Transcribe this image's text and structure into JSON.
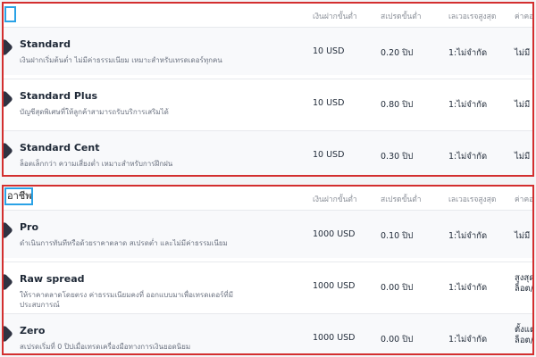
{
  "columns": [
    "เงินฝากขั้นต่ำ",
    "สเปรดขั้นต่ำ",
    "เลเวอเรจสูงสุด",
    "ค่าคอม"
  ],
  "standard_section": {
    "rows": [
      {
        "name": "Standard",
        "desc": "เงินฝากเริ่มต้นต่ำ ไม่มีค่าธรรมเนียม เหมาะสำหรับเทรดเดอร์ทุกคน",
        "deposit": "10 USD",
        "spread": "0.20 ปิป",
        "leverage": "1:ไม่จำกัด",
        "commission": "ไม่มี"
      },
      {
        "name": "Standard Plus",
        "desc": "บัญชีสุดพิเศษที่ให้ลูกค้าสามารถรับบริการเสริมได้",
        "deposit": "10 USD",
        "spread": "0.80 ปิป",
        "leverage": "1:ไม่จำกัด",
        "commission": "ไม่มี"
      },
      {
        "name": "Standard Cent",
        "desc": "ล็อตเล็กกว่า ความเสี่ยงต่ำ เหมาะสำหรับการฝึกฝน",
        "deposit": "10 USD",
        "spread": "0.30 ปิป",
        "leverage": "1:ไม่จำกัด",
        "commission": "ไม่มี"
      }
    ]
  },
  "pro_section": {
    "title": "อาชีพ",
    "rows": [
      {
        "name": "Pro",
        "desc": "ดำเนินการทันทีหรือด้วยราคาตลาด สเปรดต่ำ และไม่มีค่าธรรมเนียม",
        "deposit": "1000 USD",
        "spread": "0.10 ปิป",
        "leverage": "1:ไม่จำกัด",
        "commission": "ไม่มี"
      },
      {
        "name": "Raw spread",
        "desc": "ให้ราคาตลาดโดยตรง ค่าธรรมเนียมคงที่ ออกแบบมาเพื่อเทรดเดอร์ที่มีประสบการณ์",
        "deposit": "1000 USD",
        "spread": "0.00 ปิป",
        "leverage": "1:ไม่จำกัด",
        "commission": "สูงสุด ล็อต/ข"
      },
      {
        "name": "Zero",
        "desc": "สเปรดเริ่มที่ 0 ปิปเมื่อเทรดเครื่องมือทางการเงินยอดนิยม",
        "deposit": "1000 USD",
        "spread": "0.00 ปิป",
        "leverage": "1:ไม่จำกัด",
        "commission": "ตั้งแต่ ล็อต/ข"
      }
    ]
  }
}
